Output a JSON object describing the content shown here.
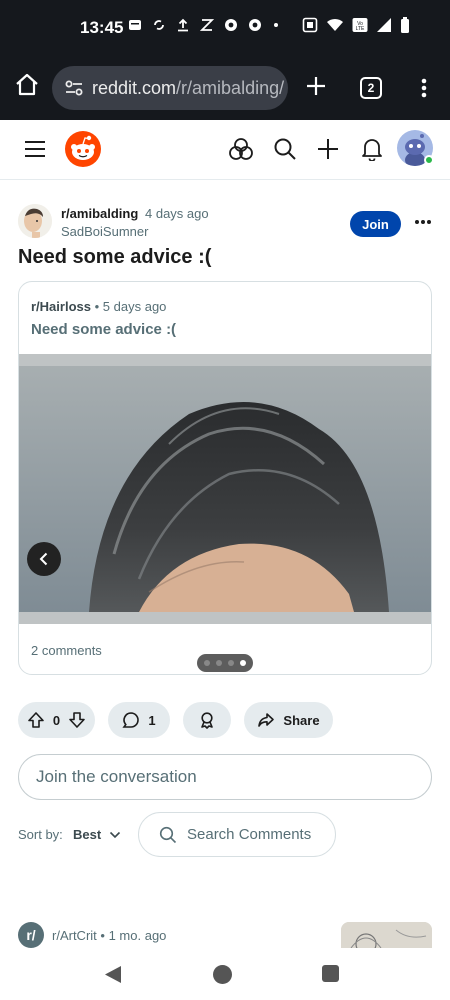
{
  "status_bar": {
    "time": "13:45"
  },
  "browser": {
    "url_host": "reddit.com",
    "url_path": "/r/amibalding/",
    "tab_count": "2"
  },
  "post": {
    "subreddit": "r/amibalding",
    "age": "4 days ago",
    "author": "SadBoiSumner",
    "join_label": "Join",
    "title": "Need some advice :("
  },
  "crosspost": {
    "subreddit": "r/Hairloss",
    "separator": "•",
    "age": "5 days ago",
    "title": "Need some advice :(",
    "comments": "2 comments",
    "gallery_total": 4,
    "gallery_current": 4
  },
  "actions": {
    "votes": "0",
    "comments": "1",
    "share_label": "Share"
  },
  "composer": {
    "placeholder": "Join the conversation"
  },
  "sort": {
    "label": "Sort by:",
    "value": "Best",
    "search_placeholder": "Search Comments"
  },
  "next_post": {
    "avatar_text": "r/",
    "subreddit": "r/ArtCrit",
    "separator": "•",
    "age": "1 mo. ago"
  },
  "colors": {
    "join_button": "#0045ac",
    "pill_bg": "#e5ebee",
    "muted_text": "#576f76",
    "reddit_orange": "#ff4500"
  }
}
